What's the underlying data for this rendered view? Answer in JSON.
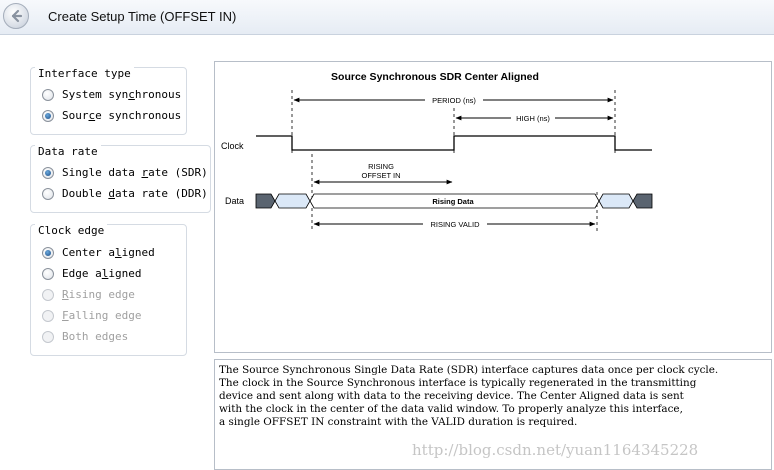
{
  "window": {
    "title": "Create Setup Time (OFFSET IN)"
  },
  "interface_type": {
    "legend": "Interface type",
    "options": [
      {
        "pre": "System syn",
        "key": "c",
        "post": "hronous",
        "checked": false,
        "enabled": true
      },
      {
        "pre": "Sour",
        "key": "c",
        "post": "e synchronous",
        "checked": true,
        "enabled": true
      }
    ]
  },
  "data_rate": {
    "legend": "Data rate",
    "options": [
      {
        "pre": "Single data ",
        "key": "r",
        "post": "ate (SDR)",
        "checked": true,
        "enabled": true
      },
      {
        "pre": "Double ",
        "key": "d",
        "post": "ata rate (DDR)",
        "checked": false,
        "enabled": true
      }
    ]
  },
  "clock_edge": {
    "legend": "Clock edge",
    "options": [
      {
        "pre": "Center a",
        "key": "l",
        "post": "igned",
        "checked": true,
        "enabled": true
      },
      {
        "pre": "Edge a",
        "key": "l",
        "post": "igned",
        "checked": false,
        "enabled": true
      },
      {
        "pre": "",
        "key": "R",
        "post": "ising edge",
        "checked": false,
        "enabled": false
      },
      {
        "pre": "",
        "key": "F",
        "post": "alling edge",
        "checked": false,
        "enabled": false
      },
      {
        "pre": "Both edges",
        "key": "",
        "post": "",
        "checked": false,
        "enabled": false
      }
    ]
  },
  "diagram": {
    "title": "Source Synchronous SDR Center Aligned",
    "period_label": "PERIOD (ns)",
    "high_label": "HIGH (ns)",
    "clock_label": "Clock",
    "data_label": "Data",
    "rising_label_1": "RISING",
    "rising_label_2": "OFFSET IN",
    "rising_data_label": "Rising Data",
    "rising_valid_label": "RISING VALID"
  },
  "description": {
    "lines": [
      "The Source Synchronous Single Data Rate (SDR) interface captures data once per clock cycle.",
      "The clock in the Source Synchronous interface is typically regenerated in the transmitting",
      "device and sent along with data to the receiving device. The Center Aligned data is sent",
      "with the clock in the center of the data valid window. To properly analyze this interface,",
      "a single OFFSET IN constraint with the VALID duration is required."
    ]
  },
  "watermark": "http://blog.csdn.net/yuan1164345228",
  "colors": {
    "clock_line": "#000000",
    "data_fill": "#ffffff",
    "transition_fill": "#dbe8f7",
    "invalid_fill": "#5a6470"
  }
}
